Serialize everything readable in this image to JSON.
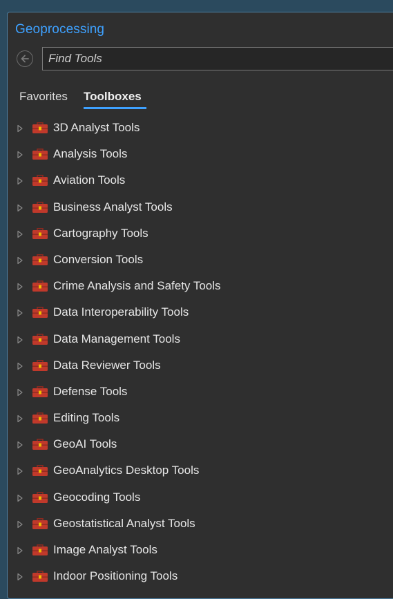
{
  "panel": {
    "title": "Geoprocessing"
  },
  "search": {
    "placeholder": "Find Tools",
    "value": ""
  },
  "tabs": [
    {
      "label": "Favorites",
      "active": false
    },
    {
      "label": "Toolboxes",
      "active": true
    }
  ],
  "colors": {
    "accent": "#3ea1ff",
    "toolbox_icon": "#c0392b",
    "toolbox_clasp": "#f0c000"
  },
  "icons": {
    "back": "back-arrow-icon",
    "expander": "expand-triangle-icon",
    "toolbox": "toolbox-icon"
  },
  "toolboxes": [
    "3D Analyst Tools",
    "Analysis Tools",
    "Aviation Tools",
    "Business Analyst Tools",
    "Cartography Tools",
    "Conversion Tools",
    "Crime Analysis and Safety Tools",
    "Data Interoperability Tools",
    "Data Management Tools",
    "Data Reviewer Tools",
    "Defense Tools",
    "Editing Tools",
    "GeoAI Tools",
    "GeoAnalytics Desktop Tools",
    "Geocoding Tools",
    "Geostatistical Analyst Tools",
    "Image Analyst Tools",
    "Indoor Positioning Tools"
  ]
}
